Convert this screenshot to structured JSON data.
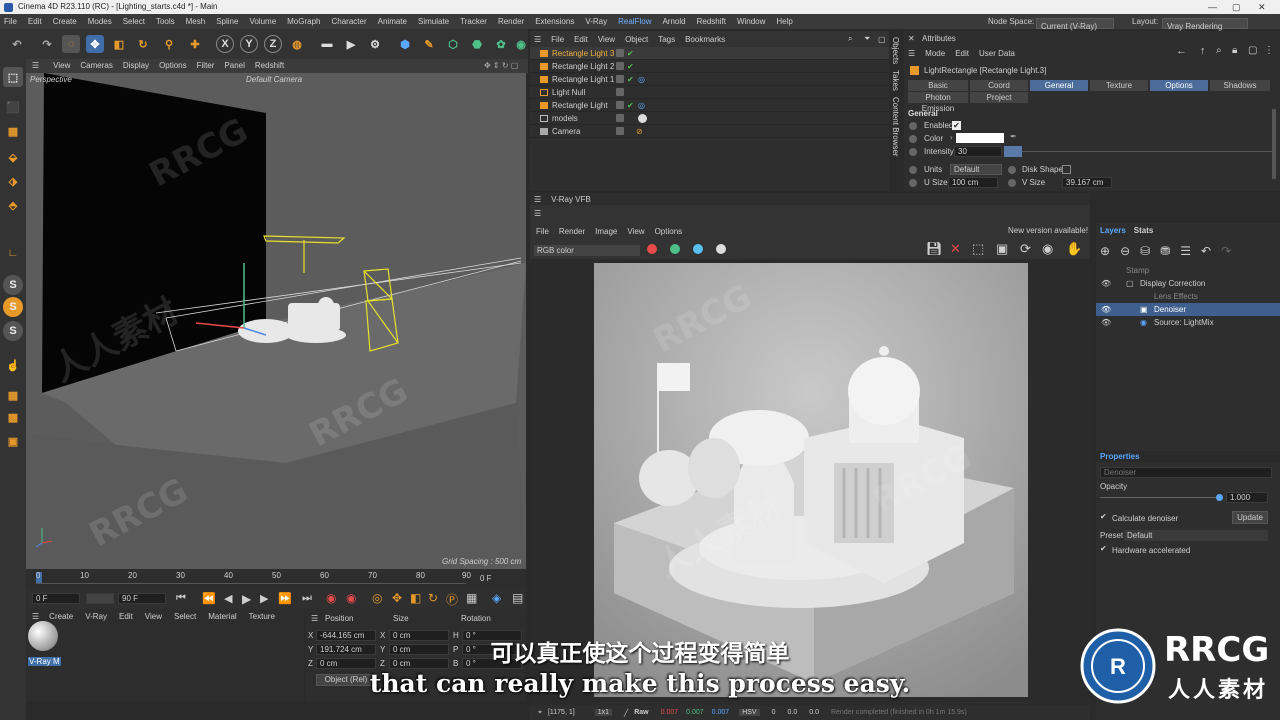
{
  "window": {
    "title": "Cinema 4D R23.110 (RC) - [Lighting_starts.c4d *] - Main"
  },
  "menubar": {
    "items": [
      "File",
      "Edit",
      "Create",
      "Modes",
      "Select",
      "Tools",
      "Mesh",
      "Spline",
      "Volume",
      "MoGraph",
      "Character",
      "Animate",
      "Simulate",
      "Tracker",
      "Render",
      "Extensions",
      "V-Ray",
      "RealFlow",
      "Arnold",
      "Redshift",
      "Window",
      "Help"
    ],
    "node_space_label": "Node Space:",
    "node_space_value": "Current (V-Ray)",
    "layout_label": "Layout:",
    "layout_value": "Vray Rendering (User)"
  },
  "toolbar": {
    "axis_x": "X",
    "axis_y": "Y",
    "axis_z": "Z"
  },
  "viewport": {
    "menu": [
      "View",
      "Cameras",
      "Display",
      "Options",
      "Filter",
      "Panel",
      "Redshift"
    ],
    "name": "Perspective",
    "camera": "Default Camera",
    "grid_spacing": "Grid Spacing : 500 cm"
  },
  "timeline": {
    "ticks": [
      "0",
      "10",
      "20",
      "30",
      "40",
      "50",
      "60",
      "70",
      "80",
      "90"
    ],
    "frame_end_label": "0 F",
    "current_frame": "0 F",
    "max_frame": "90 F"
  },
  "materials": {
    "menu": [
      "Create",
      "V-Ray",
      "Edit",
      "View",
      "Select",
      "Material",
      "Texture"
    ],
    "material_name": "V-Ray M"
  },
  "coordinates": {
    "headers": [
      "Position",
      "Size",
      "Rotation"
    ],
    "rows": [
      {
        "axis": "X",
        "position": "-644.165 cm",
        "size_axis": "X",
        "size": "0 cm",
        "rot_axis": "H",
        "rotation": "0 °"
      },
      {
        "axis": "Y",
        "position": "191.724 cm",
        "size_axis": "Y",
        "size": "0 cm",
        "rot_axis": "P",
        "rotation": "0 °"
      },
      {
        "axis": "Z",
        "position": "0 cm",
        "size_axis": "Z",
        "size": "0 cm",
        "rot_axis": "B",
        "rotation": "0 °"
      }
    ],
    "mode": "Object (Rel)"
  },
  "objects": {
    "menu": [
      "File",
      "Edit",
      "View",
      "Object",
      "Tags",
      "Bookmarks"
    ],
    "items": [
      {
        "name": "Rectangle Light 3",
        "selected": true
      },
      {
        "name": "Rectangle Light 2",
        "selected": false
      },
      {
        "name": "Rectangle Light 1",
        "selected": false
      },
      {
        "name": "Light Null",
        "selected": false
      },
      {
        "name": "Rectangle Light",
        "selected": false
      },
      {
        "name": "models",
        "selected": false
      },
      {
        "name": "Camera",
        "selected": false
      }
    ],
    "side_tabs": [
      "Objects",
      "Takes",
      "Content Browser"
    ]
  },
  "attributes": {
    "title": "Attributes",
    "menu": [
      "Mode",
      "Edit",
      "User Data"
    ],
    "object_name": "LightRectangle [Rectangle Light.3]",
    "tabs_row1": [
      "Basic",
      "Coord",
      "General",
      "Texture",
      "Options",
      "Shadows"
    ],
    "tabs_row2": [
      "Photon Emission",
      "Project"
    ],
    "section": "General",
    "enabled_label": "Enabled",
    "color_label": "Color",
    "intensity_label": "Intensity",
    "intensity_value": "30",
    "units_label": "Units",
    "units_value": "Default",
    "disk_shape_label": "Disk Shape",
    "u_size_label": "U Size",
    "u_size_value": "100 cm",
    "v_size_label": "V Size",
    "v_size_value": "39.167 cm"
  },
  "vfb": {
    "title": "V-Ray VFB",
    "menu": [
      "File",
      "Render",
      "Image",
      "View",
      "Options"
    ],
    "new_version": "New version available!",
    "channel": "RGB color",
    "status": {
      "coords": "[1175, 1]",
      "zoom": "1x1",
      "mode": "Raw",
      "r": "0.007",
      "g": "0.007",
      "b": "0.007",
      "color_space": "HSV",
      "h": "0",
      "s": "0.0",
      "v": "0.0",
      "render_status": "Render completed (finished in 0h 1m 15.9s)"
    }
  },
  "layers": {
    "tabs": [
      "Layers",
      "Stats"
    ],
    "items": [
      "Stamp",
      "Display Correction",
      "Lens Effects",
      "Denoiser",
      "Source: LightMix"
    ],
    "properties_title": "Properties",
    "selected_name": "Denoiser",
    "opacity_label": "Opacity",
    "opacity_value": "1.000",
    "opacity_fraction": 1.0,
    "calc_denoiser": "Calculate denoiser",
    "update": "Update",
    "preset_label": "Preset",
    "preset_value": "Default",
    "hw_accel": "Hardware accelerated"
  },
  "subtitles": {
    "cn": "可以真正使这个过程变得简单",
    "en": "that can really make this process easy."
  },
  "watermark": {
    "brand": "RRCG",
    "cn": "人人素材"
  }
}
